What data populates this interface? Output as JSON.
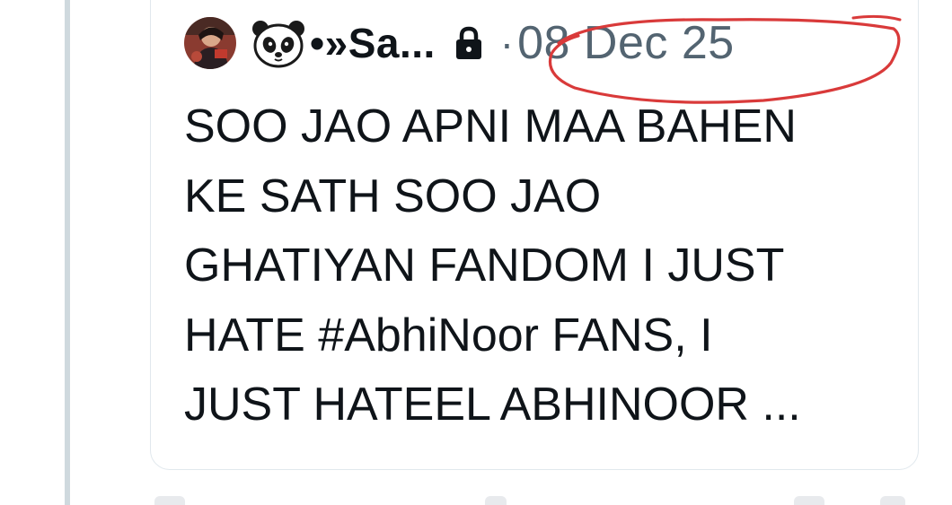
{
  "quoted_tweet": {
    "display_name": "•»Sa...",
    "timestamp": "08 Dec 25",
    "separator": "·",
    "text_lines": [
      "SOO JAO APNI MAA BAHEN",
      "KE SATH SOO JAO",
      "GHATIYAN FANDOM I JUST",
      "HATE #AbhiNoor FANS, I",
      "JUST HATEEL ABHINOOR ..."
    ],
    "icons": {
      "avatar": "profile-avatar",
      "name_emoji": "panda-icon",
      "protected": "lock-icon"
    }
  },
  "colors": {
    "text_primary": "#0f1419",
    "text_secondary": "#536471",
    "card_border": "#e1e8ed",
    "thread_line": "#cfd9de",
    "annotation_circle": "#d93a3a"
  }
}
